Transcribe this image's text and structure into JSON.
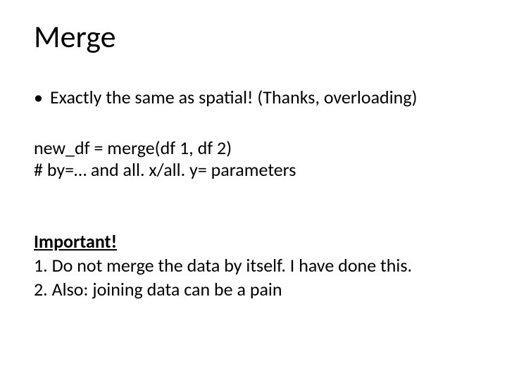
{
  "title": "Merge",
  "bullet": "Exactly the same as spatial! (Thanks, overloading)",
  "code_line1": "new_df = merge(df 1, df 2)",
  "code_line2": "# by=… and all. x/all. y= parameters",
  "important_label": "Important!",
  "important_line1": "1. Do not merge the data by itself. I have done this.",
  "important_line2": "2. Also: joining data can be a pain"
}
